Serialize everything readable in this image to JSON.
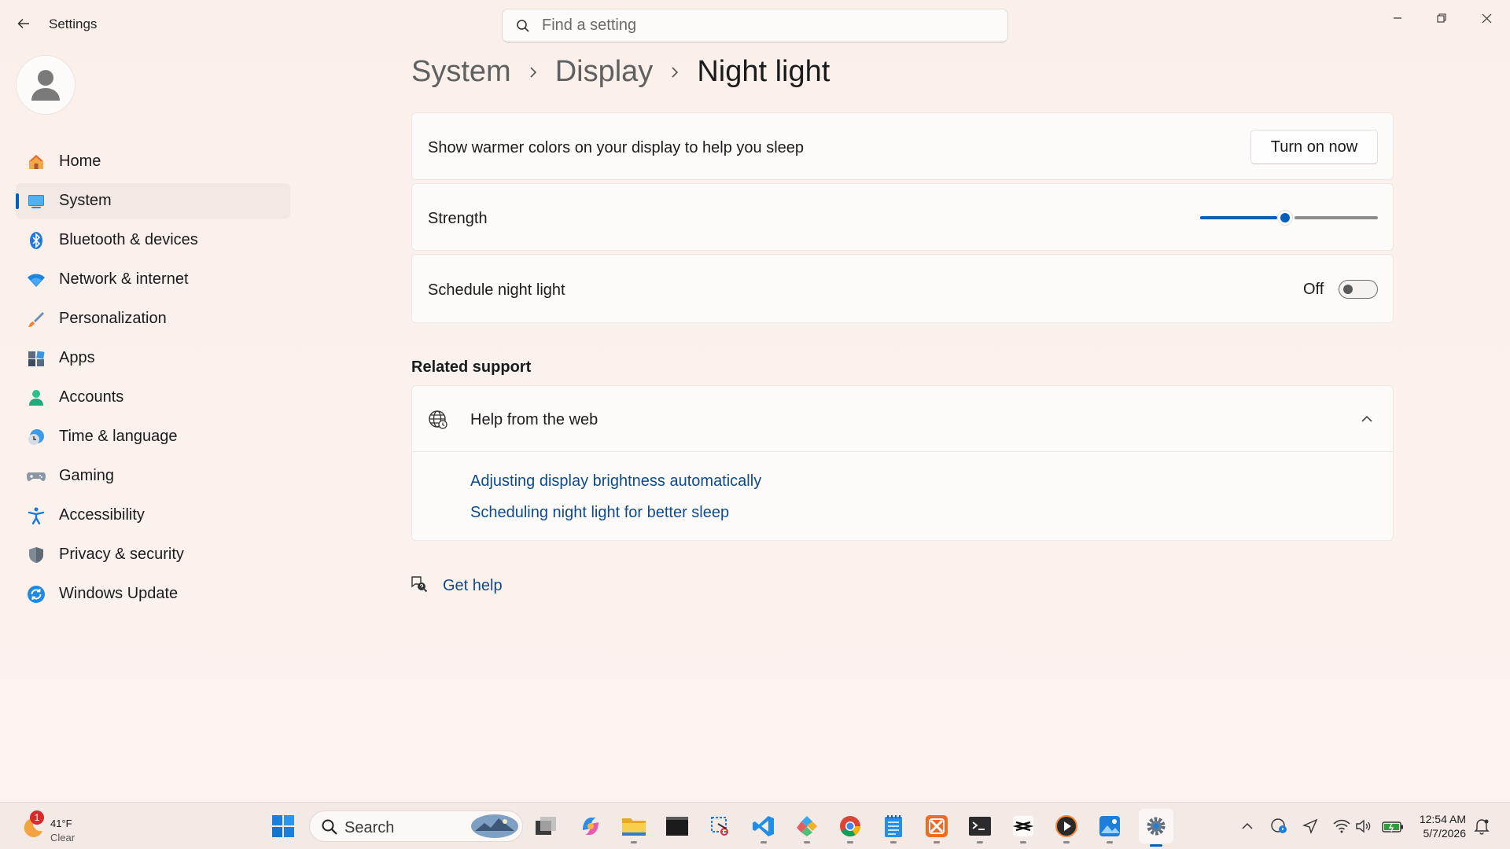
{
  "app": {
    "title": "Settings"
  },
  "search": {
    "placeholder": "Find a setting"
  },
  "sidebar": {
    "items": [
      {
        "label": "Home",
        "icon": "home-icon"
      },
      {
        "label": "System",
        "icon": "system-icon",
        "active": true
      },
      {
        "label": "Bluetooth & devices",
        "icon": "bluetooth-icon"
      },
      {
        "label": "Network & internet",
        "icon": "wifi-icon"
      },
      {
        "label": "Personalization",
        "icon": "brush-icon"
      },
      {
        "label": "Apps",
        "icon": "apps-icon"
      },
      {
        "label": "Accounts",
        "icon": "accounts-icon"
      },
      {
        "label": "Time & language",
        "icon": "time-language-icon"
      },
      {
        "label": "Gaming",
        "icon": "gaming-icon"
      },
      {
        "label": "Accessibility",
        "icon": "accessibility-icon"
      },
      {
        "label": "Privacy & security",
        "icon": "shield-icon"
      },
      {
        "label": "Windows Update",
        "icon": "update-icon"
      }
    ]
  },
  "breadcrumb": {
    "level1": "System",
    "level2": "Display",
    "current": "Night light"
  },
  "night_light": {
    "description": "Show warmer colors on your display to help you sleep",
    "turn_on_button": "Turn on now",
    "strength_label": "Strength",
    "strength_value": 48,
    "schedule_label": "Schedule night light",
    "schedule_state": "Off"
  },
  "related_support": {
    "title": "Related support",
    "help_header": "Help from the web",
    "links": [
      "Adjusting display brightness automatically",
      "Scheduling night light for better sleep"
    ]
  },
  "get_help": "Get help",
  "taskbar": {
    "weather_badge": "1",
    "weather_temp": "41°F",
    "weather_condition": "Clear",
    "search_label": "Search",
    "time": "12:54 AM",
    "date": "5/7/2026"
  },
  "colors": {
    "accent": "#005fb8",
    "link": "#0f4a8a",
    "background": "#fbefe9"
  }
}
